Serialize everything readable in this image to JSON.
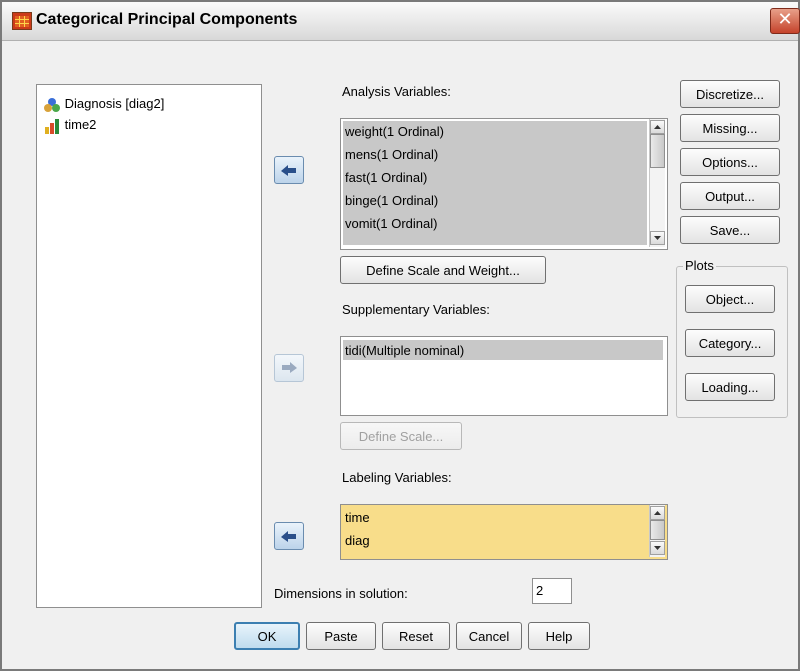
{
  "window": {
    "title": "Categorical Principal Components"
  },
  "source_list": {
    "items": [
      {
        "label": "Diagnosis [diag2]",
        "icon": "nominal-variable-icon"
      },
      {
        "label": "time2",
        "icon": "scale-variable-icon"
      }
    ]
  },
  "analysis": {
    "label": "Analysis Variables:",
    "items": [
      "weight(1 Ordinal)",
      "mens(1 Ordinal)",
      "fast(1 Ordinal)",
      "binge(1 Ordinal)",
      "vomit(1 Ordinal)"
    ],
    "define_button": "Define Scale and Weight..."
  },
  "supplementary": {
    "label": "Supplementary Variables:",
    "items": [
      "tidi(Multiple nominal)"
    ],
    "define_button": "Define Scale..."
  },
  "labeling": {
    "label": "Labeling Variables:",
    "items": [
      "time",
      "diag"
    ]
  },
  "dimensions": {
    "label": "Dimensions in solution:",
    "value": "2"
  },
  "side_buttons": [
    "Discretize...",
    "Missing...",
    "Options...",
    "Output...",
    "Save..."
  ],
  "plots": {
    "label": "Plots",
    "buttons": [
      "Object...",
      "Category...",
      "Loading..."
    ]
  },
  "footer_buttons": [
    "OK",
    "Paste",
    "Reset",
    "Cancel",
    "Help"
  ],
  "colors": {
    "selection": "#c8c8c8",
    "label_highlight": "#f8dd8a",
    "title_bar": "#e4e4e4"
  }
}
